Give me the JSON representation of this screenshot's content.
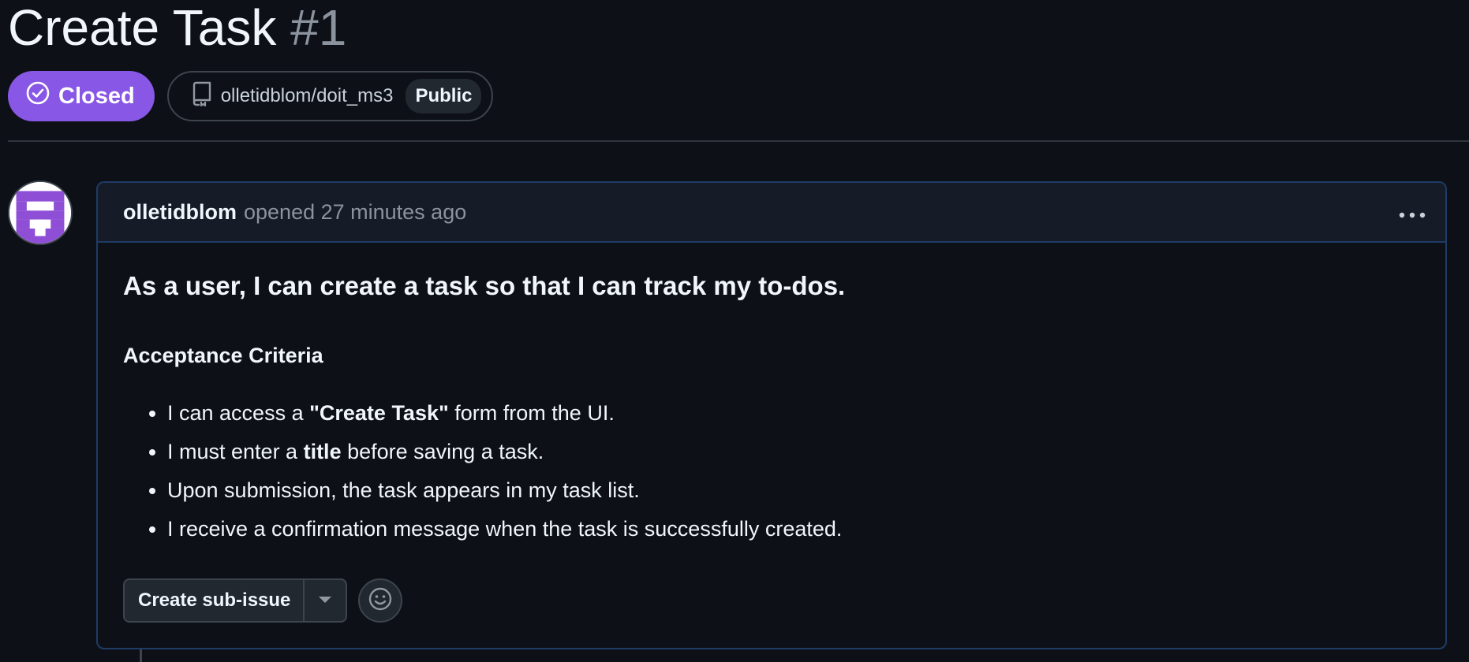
{
  "issue": {
    "title": "Create Task",
    "number": "#1",
    "state": "Closed",
    "state_color": "#8957e5",
    "repo": "olletidblom/doit_ms3",
    "visibility": "Public"
  },
  "comment": {
    "author": "olletidblom",
    "opened_text": "opened 27 minutes ago",
    "menu_icon": "kebab-horizontal-icon",
    "story": "As a user, I can create a task so that I can track my to-dos.",
    "criteria_heading": "Acceptance Criteria",
    "criteria": [
      {
        "pre": "I can access a ",
        "bold": "\"Create Task\"",
        "post": " form from the UI."
      },
      {
        "pre": "I must enter a ",
        "bold": "title",
        "post": " before saving a task."
      },
      {
        "pre": "Upon submission, the task appears in my task list.",
        "bold": "",
        "post": ""
      },
      {
        "pre": "I receive a confirmation message when the task is successfully created.",
        "bold": "",
        "post": ""
      }
    ],
    "sub_issue_button": "Create sub-issue",
    "reaction_icon": "smiley-icon"
  },
  "colors": {
    "background": "#0d1117",
    "comment_border": "#1f3b66",
    "header_bg": "#151b27"
  }
}
